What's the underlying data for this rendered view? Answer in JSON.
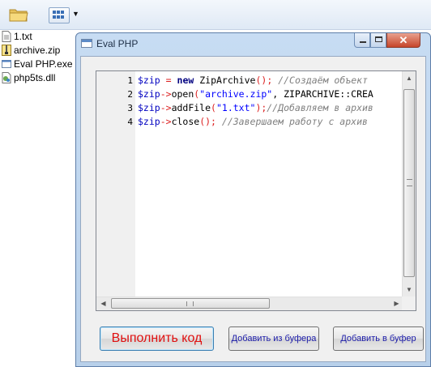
{
  "toolbar": {
    "folder_icon": "folder-icon",
    "view_icon": "view-options-icon",
    "arrow_icon": "chevron-down-icon"
  },
  "files": [
    {
      "name": "1.txt",
      "icon": "text-file-icon"
    },
    {
      "name": "archive.zip",
      "icon": "zip-file-icon"
    },
    {
      "name": "Eval PHP.exe",
      "icon": "exe-file-icon"
    },
    {
      "name": "php5ts.dll",
      "icon": "dll-file-icon"
    }
  ],
  "window": {
    "title": "Eval PHP",
    "min_glyph": "",
    "max_glyph": "",
    "close_glyph": "✕"
  },
  "editor": {
    "lines": [
      {
        "n": "1",
        "tokens": [
          [
            "var",
            "$zip"
          ],
          [
            "plain",
            " "
          ],
          [
            "op",
            "="
          ],
          [
            "plain",
            " "
          ],
          [
            "kw",
            "new"
          ],
          [
            "plain",
            " ZipArchive"
          ],
          [
            "op",
            "();"
          ],
          [
            "plain",
            " "
          ],
          [
            "cmt",
            "//Создаём объект"
          ]
        ]
      },
      {
        "n": "2",
        "tokens": [
          [
            "var",
            "$zip"
          ],
          [
            "op",
            "->"
          ],
          [
            "plain",
            "open"
          ],
          [
            "op",
            "("
          ],
          [
            "str",
            "\"archive.zip\""
          ],
          [
            "plain",
            ", ZIPARCHIVE::CREA"
          ]
        ]
      },
      {
        "n": "3",
        "tokens": [
          [
            "var",
            "$zip"
          ],
          [
            "op",
            "->"
          ],
          [
            "plain",
            "addFile"
          ],
          [
            "op",
            "("
          ],
          [
            "str",
            "\"1.txt\""
          ],
          [
            "op",
            ");"
          ],
          [
            "cmt",
            "//Добавляем в архив"
          ]
        ]
      },
      {
        "n": "4",
        "tokens": [
          [
            "var",
            "$zip"
          ],
          [
            "op",
            "->"
          ],
          [
            "plain",
            "close"
          ],
          [
            "op",
            "();"
          ],
          [
            "plain",
            " "
          ],
          [
            "cmt",
            "//Завершаем работу с архив"
          ]
        ]
      }
    ],
    "scroll_up": "▲",
    "scroll_down": "▼",
    "scroll_left": "◀",
    "scroll_right": "▶"
  },
  "buttons": {
    "run": "Выполнить код",
    "paste": "Добавить из буфера",
    "copy": "Добавить в буфер"
  },
  "colors": {
    "run_text": "#e01010",
    "button_text": "#1a1aa8"
  }
}
